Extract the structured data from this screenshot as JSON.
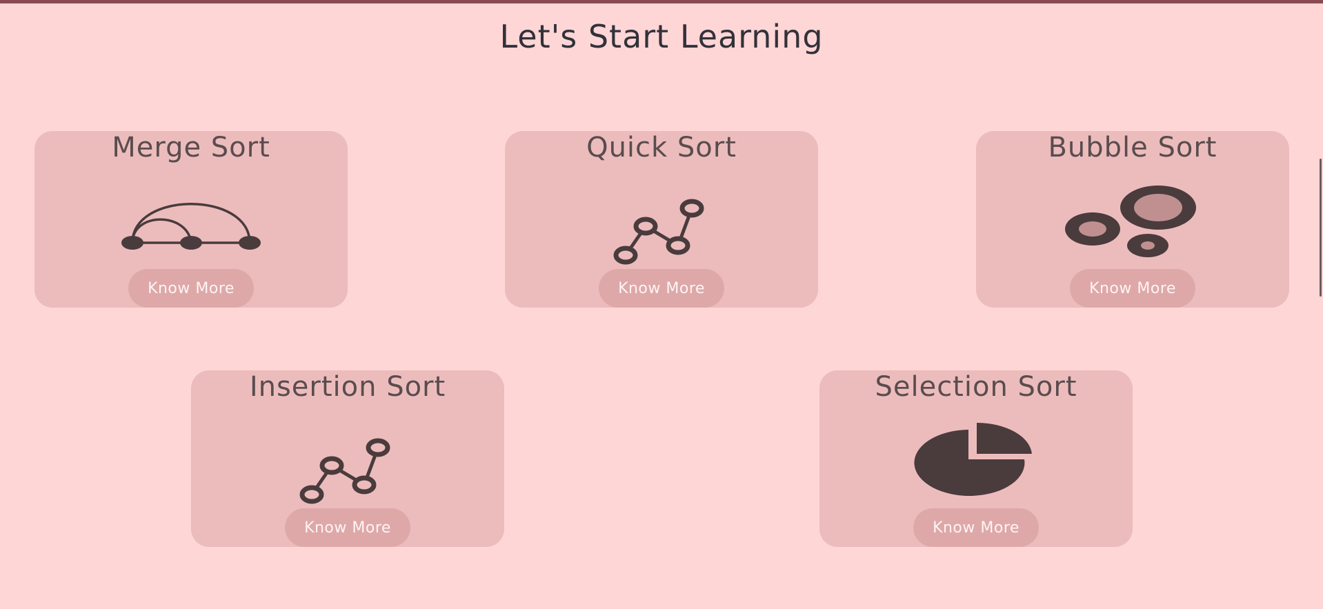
{
  "page": {
    "title": "Let's Start Learning"
  },
  "cards": [
    {
      "title": "Merge Sort",
      "button": "Know More",
      "icon": "merge-sort-arc-icon"
    },
    {
      "title": "Quick Sort",
      "button": "Know More",
      "icon": "line-graph-icon"
    },
    {
      "title": "Bubble Sort",
      "button": "Know More",
      "icon": "bubbles-icon"
    },
    {
      "title": "Insertion Sort",
      "button": "Know More",
      "icon": "line-graph-icon"
    },
    {
      "title": "Selection Sort",
      "button": "Know More",
      "icon": "pie-chart-icon"
    }
  ],
  "colors": {
    "background": "#ffd6d6",
    "card": "#ecbcbc",
    "button": "#dea8a9",
    "icon": "#4a3b3d",
    "top_bar": "#8a4a52"
  }
}
